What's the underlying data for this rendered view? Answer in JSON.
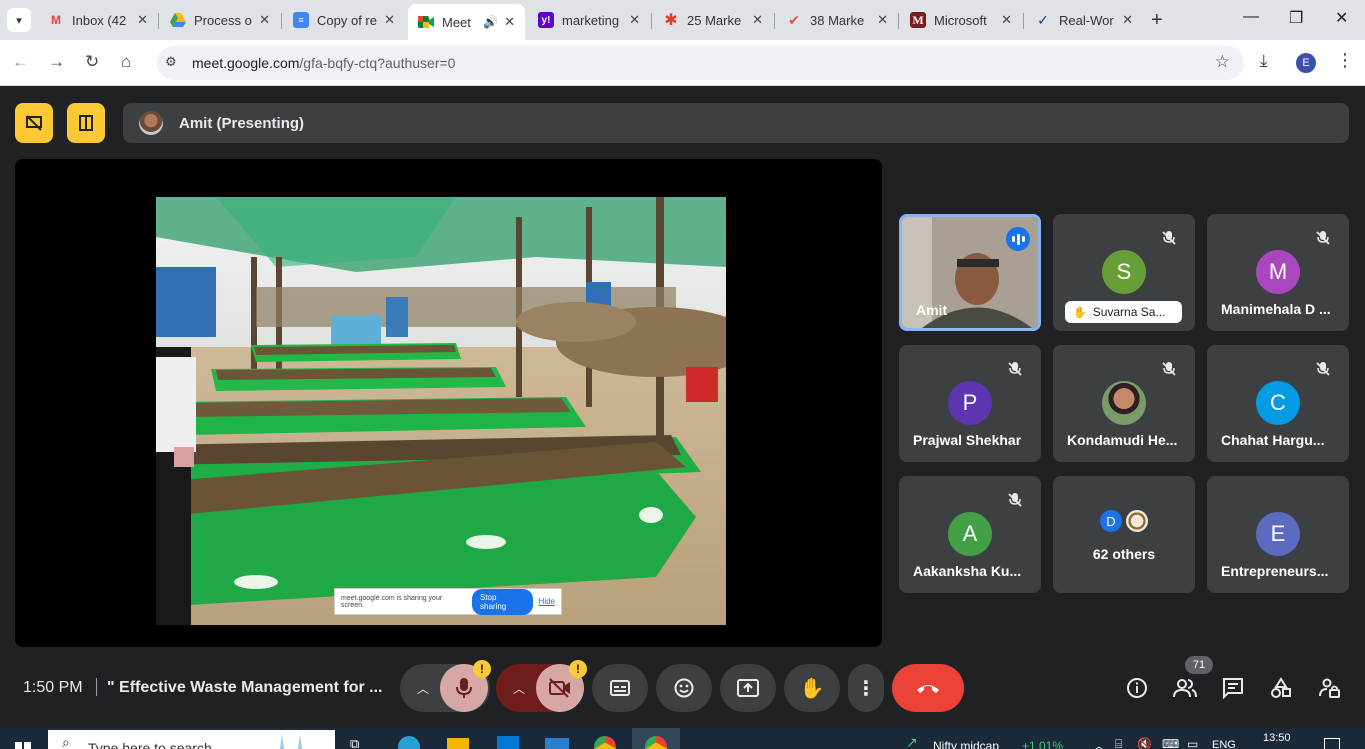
{
  "browser": {
    "tabs": [
      {
        "label": "Inbox (42",
        "icon": "gmail-icon"
      },
      {
        "label": "Process o",
        "icon": "drive-icon"
      },
      {
        "label": "Copy of re",
        "icon": "docs-icon"
      },
      {
        "label": "Meet",
        "icon": "meet-icon",
        "active": true
      },
      {
        "label": "marketing",
        "icon": "yahoo-icon"
      },
      {
        "label": "25 Marke",
        "icon": "asterisk-icon"
      },
      {
        "label": "38 Marke",
        "icon": "check-icon"
      },
      {
        "label": "Microsoft",
        "icon": "m-icon"
      },
      {
        "label": "Real-Wor",
        "icon": "v-icon"
      }
    ],
    "url_host": "meet.google.com",
    "url_path": "/gfa-bqfy-ctq?authuser=0",
    "profile_initial": "E"
  },
  "meet": {
    "presenting_label": "Amit (Presenting)",
    "share_notice": {
      "message": "meet.google.com is sharing your screen.",
      "stop_label": "Stop sharing",
      "hide_label": "Hide"
    },
    "tiles": [
      {
        "name": "Amit",
        "speaking": true
      },
      {
        "name": "Suvarna Sa...",
        "initial": "S",
        "color": "#689f38",
        "hand": true
      },
      {
        "name": "Manimehala D ...",
        "initial": "M",
        "color": "#ab47bc"
      },
      {
        "name": "Prajwal Shekhar",
        "initial": "P",
        "color": "#5e35b1"
      },
      {
        "name": "Kondamudi He..."
      },
      {
        "name": "Chahat Hargu...",
        "initial": "C",
        "color": "#039be5"
      },
      {
        "name": "Aakanksha Ku...",
        "initial": "A",
        "color": "#43a047"
      },
      {
        "name": "62 others",
        "initial": "D"
      },
      {
        "name": "Entrepreneurs...",
        "initial": "E",
        "color": "#5c6bc0"
      }
    ],
    "time": "1:50 PM",
    "meeting_title": "\" Effective Waste Management for ...",
    "warn_mark": "!",
    "participants_count": "71"
  },
  "taskbar": {
    "search_placeholder": "Type here to search",
    "stock": "Nifty midcap",
    "stock_change": "+1.01%",
    "lang": "ENG",
    "clock": "13:50"
  }
}
